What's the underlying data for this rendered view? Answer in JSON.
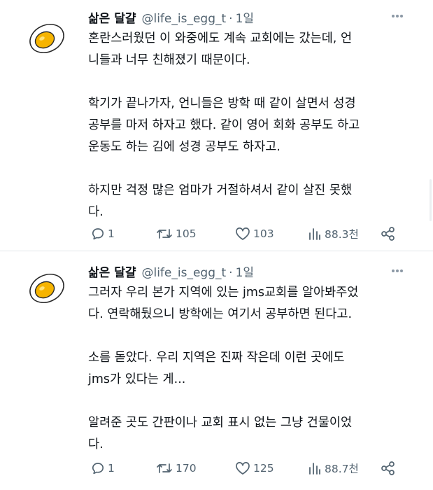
{
  "tweets": [
    {
      "display_name": "삶은 달걀",
      "handle": "@life_is_egg_t",
      "separator": "·",
      "time": "1일",
      "paragraphs": [
        "혼란스러웠던 이 와중에도 계속 교회에는 갔는데, 언\n니들과 너무 친해졌기 때문이다.",
        "학기가 끝나가자, 언니들은 방학 때 같이 살면서 성경\n공부를 마저 하자고 했다. 같이 영어 회화 공부도 하고\n운동도 하는 김에 성경 공부도 하자고.",
        "하지만 걱정 많은 엄마가 거절하셔서 같이 살진 못했\n다."
      ],
      "stats": {
        "replies": "1",
        "retweets": "105",
        "likes": "103",
        "views": "88.3천"
      }
    },
    {
      "display_name": "삶은 달걀",
      "handle": "@life_is_egg_t",
      "separator": "·",
      "time": "1일",
      "paragraphs": [
        "그러자 우리 본가 지역에 있는 jms교회를 알아봐주었\n다. 연락해뒀으니 방학에는 여기서 공부하면 된다고.",
        "소름 돋았다. 우리 지역은 진짜 작은데 이런 곳에도\njms가 있다는 게...",
        "알려준 곳도 간판이나 교회 표시 없는 그냥 건물이었\n다."
      ],
      "stats": {
        "replies": "1",
        "retweets": "170",
        "likes": "125",
        "views": "88.7천"
      }
    }
  ],
  "icons": {
    "avatar": "boiled-egg-half",
    "more": "more-dots-icon",
    "reply": "reply-icon",
    "retweet": "retweet-icon",
    "like": "heart-icon",
    "views": "views-chart-icon",
    "share": "share-icon"
  },
  "colors": {
    "text": "#0f1419",
    "muted": "#536471",
    "yolk": "#f6b400",
    "egg_white": "#ffffff"
  }
}
